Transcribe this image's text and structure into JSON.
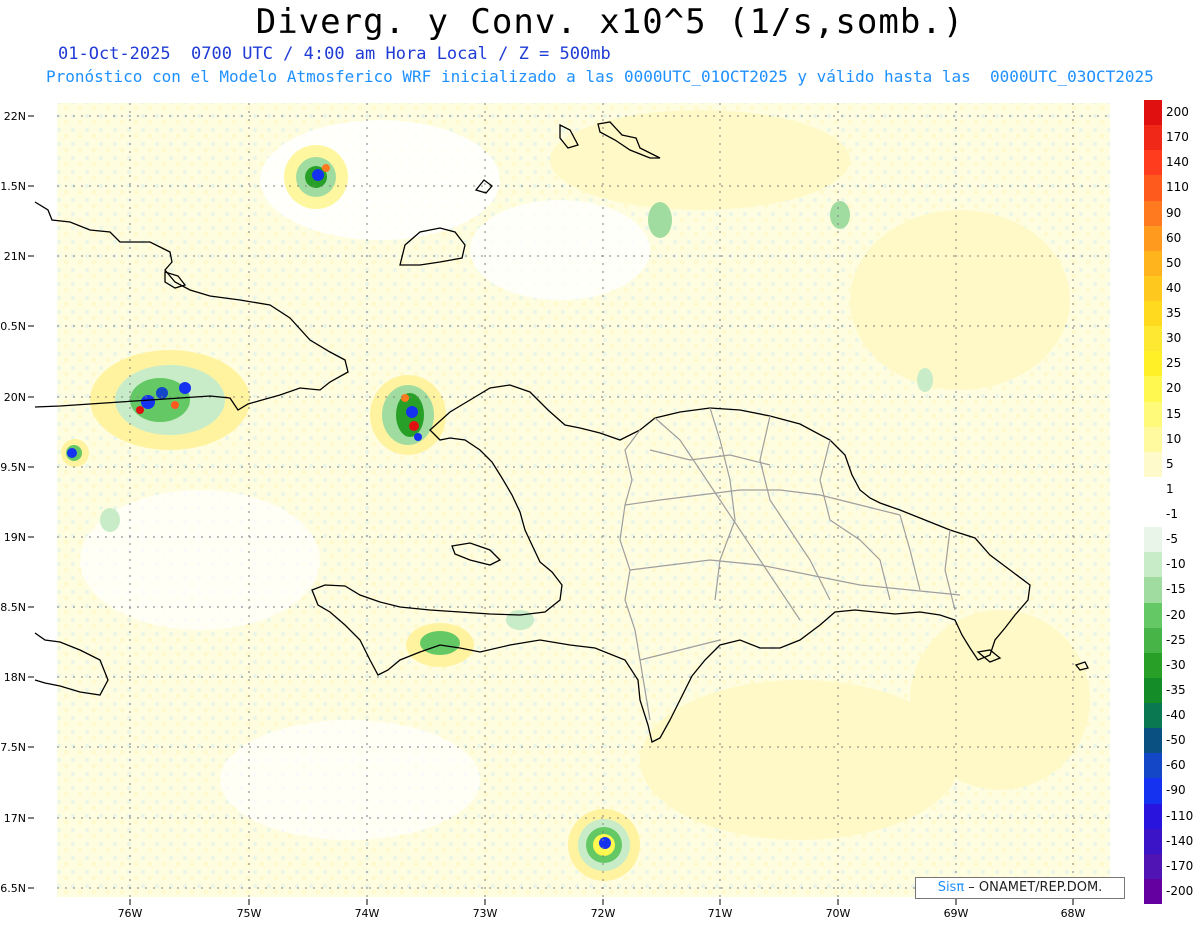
{
  "title": "Diverg. y Conv. x10^5 (1/s,somb.)",
  "subtitle_line1": "01-Oct-2025  0700 UTC / 4:00 am Hora Local / Z = 500mb",
  "subtitle_line2": "Pronóstico con el Modelo Atmosferico WRF inicializado a las 0000UTC_01OCT2025 y válido hasta las  0000UTC_03OCT2025",
  "map": {
    "lat_labels": [
      "22N",
      "1.5N",
      "21N",
      "0.5N",
      "20N",
      "9.5N",
      "19N",
      "8.5N",
      "18N",
      "7.5N",
      "17N",
      "6.5N"
    ],
    "lon_labels": [
      "76W",
      "75W",
      "74W",
      "73W",
      "72W",
      "71W",
      "70W",
      "69W",
      "68W"
    ],
    "colors": {
      "coast": "#000000",
      "province_borders": "#9e9e9e",
      "grid": "#808080"
    }
  },
  "colorbar": {
    "labels": [
      "200",
      "170",
      "140",
      "110",
      "90",
      "60",
      "50",
      "40",
      "35",
      "30",
      "25",
      "20",
      "15",
      "10",
      "5",
      "1",
      "-1",
      "-5",
      "-10",
      "-15",
      "-20",
      "-25",
      "-30",
      "-35",
      "-40",
      "-50",
      "-60",
      "-90",
      "-110",
      "-140",
      "-170",
      "-200"
    ],
    "colors": [
      "#e01010",
      "#f02818",
      "#ff3c1e",
      "#ff5a1e",
      "#ff7a1e",
      "#ff9a1e",
      "#ffb41e",
      "#ffc81e",
      "#ffda1e",
      "#ffe832",
      "#fff028",
      "#fff850",
      "#fffa7a",
      "#fffaa0",
      "#fffacc",
      "#ffffff",
      "#ffffff",
      "#e8f5e8",
      "#c8ecc8",
      "#a0dca0",
      "#64c864",
      "#46b446",
      "#28a028",
      "#148c28",
      "#0a7850",
      "#0a5080",
      "#1446c8",
      "#1432f0",
      "#2814dc",
      "#3c14c8",
      "#5014b4",
      "#6400a0"
    ]
  },
  "credit": {
    "sis": "Sisπ",
    "rest": " – ONAMET/REP.DOM."
  }
}
